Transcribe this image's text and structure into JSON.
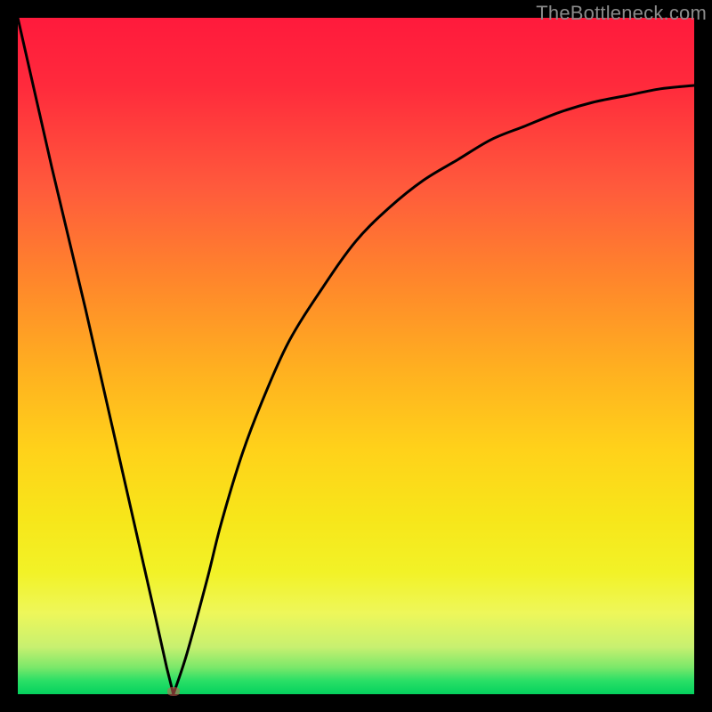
{
  "watermark": "TheBottleneck.com",
  "colors": {
    "gradient_top": "#ff1a3c",
    "gradient_bottom": "#04d15e",
    "curve": "#000000",
    "frame": "#000000",
    "marker": "rgba(210,90,80,0.55)"
  },
  "chart_data": {
    "type": "line",
    "title": "",
    "xlabel": "",
    "ylabel": "",
    "xlim": [
      0,
      100
    ],
    "ylim": [
      0,
      100
    ],
    "grid": false,
    "legend": false,
    "comment": "Bottleneck-style V-curve. y ~ 100 at x=0, drops linearly to 0 at x≈23, then rises asymptotically toward ~90 as x→100. Values are percentages read from gradient position (top=100, bottom=0).",
    "series": [
      {
        "name": "curve",
        "x": [
          0,
          5,
          10,
          15,
          20,
          22,
          23,
          25,
          28,
          30,
          33,
          36,
          40,
          45,
          50,
          55,
          60,
          65,
          70,
          75,
          80,
          85,
          90,
          95,
          100
        ],
        "y": [
          100,
          78,
          57,
          35,
          13,
          4,
          0,
          6,
          17,
          25,
          35,
          43,
          52,
          60,
          67,
          72,
          76,
          79,
          82,
          84,
          86,
          87.5,
          88.5,
          89.5,
          90
        ]
      }
    ],
    "minimum": {
      "x": 23,
      "y": 0
    }
  }
}
